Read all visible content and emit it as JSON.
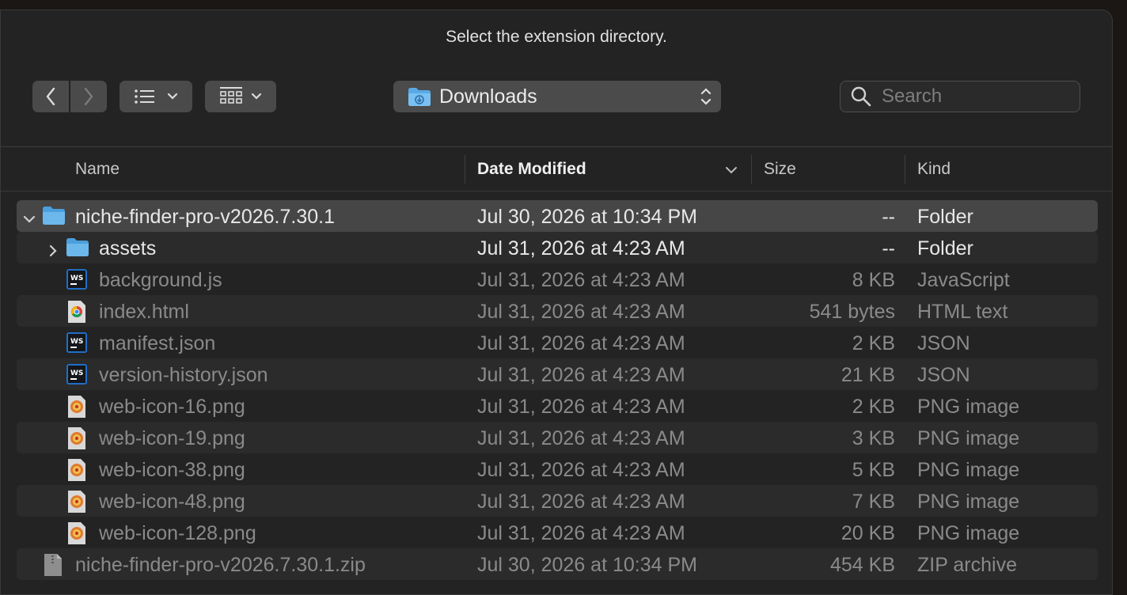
{
  "dialog": {
    "title": "Select the extension directory."
  },
  "toolbar": {
    "back_icon": "chevron-left-icon",
    "forward_icon": "chevron-right-icon",
    "view_list_icon": "list-view-icon",
    "view_grid_icon": "gallery-view-icon",
    "location": "Downloads",
    "search_placeholder": "Search"
  },
  "columns": {
    "name": "Name",
    "date": "Date Modified",
    "size": "Size",
    "kind": "Kind"
  },
  "files": [
    {
      "name": "niche-finder-pro-v2026.7.30.1",
      "date": "Jul 30, 2026 at 10:34 PM",
      "size": "--",
      "kind": "Folder",
      "icon": "folder-icon",
      "level": 0,
      "disclosure": "open"
    },
    {
      "name": "assets",
      "date": "Jul 31, 2026 at 4:23 AM",
      "size": "--",
      "kind": "Folder",
      "icon": "folder-icon",
      "level": 1,
      "disclosure": "closed"
    },
    {
      "name": "background.js",
      "date": "Jul 31, 2026 at 4:23 AM",
      "size": "8 KB",
      "kind": "JavaScript",
      "icon": "webstorm-file-icon",
      "level": 1
    },
    {
      "name": "index.html",
      "date": "Jul 31, 2026 at 4:23 AM",
      "size": "541 bytes",
      "kind": "HTML text",
      "icon": "chrome-file-icon",
      "level": 1
    },
    {
      "name": "manifest.json",
      "date": "Jul 31, 2026 at 4:23 AM",
      "size": "2 KB",
      "kind": "JSON",
      "icon": "webstorm-file-icon",
      "level": 1
    },
    {
      "name": "version-history.json",
      "date": "Jul 31, 2026 at 4:23 AM",
      "size": "21 KB",
      "kind": "JSON",
      "icon": "webstorm-file-icon",
      "level": 1
    },
    {
      "name": "web-icon-16.png",
      "date": "Jul 31, 2026 at 4:23 AM",
      "size": "2 KB",
      "kind": "PNG image",
      "icon": "png-image-icon",
      "level": 1
    },
    {
      "name": "web-icon-19.png",
      "date": "Jul 31, 2026 at 4:23 AM",
      "size": "3 KB",
      "kind": "PNG image",
      "icon": "png-image-icon",
      "level": 1
    },
    {
      "name": "web-icon-38.png",
      "date": "Jul 31, 2026 at 4:23 AM",
      "size": "5 KB",
      "kind": "PNG image",
      "icon": "png-image-icon",
      "level": 1
    },
    {
      "name": "web-icon-48.png",
      "date": "Jul 31, 2026 at 4:23 AM",
      "size": "7 KB",
      "kind": "PNG image",
      "icon": "png-image-icon",
      "level": 1
    },
    {
      "name": "web-icon-128.png",
      "date": "Jul 31, 2026 at 4:23 AM",
      "size": "20 KB",
      "kind": "PNG image",
      "icon": "png-image-icon",
      "level": 1
    },
    {
      "name": "niche-finder-pro-v2026.7.30.1.zip",
      "date": "Jul 30, 2026 at 10:34 PM",
      "size": "454 KB",
      "kind": "ZIP archive",
      "icon": "zip-file-icon",
      "level": 0
    }
  ],
  "colors": {
    "folder": "#6cb7ec",
    "selected_row": "#464646",
    "alt_row": "#2b2b2b"
  }
}
